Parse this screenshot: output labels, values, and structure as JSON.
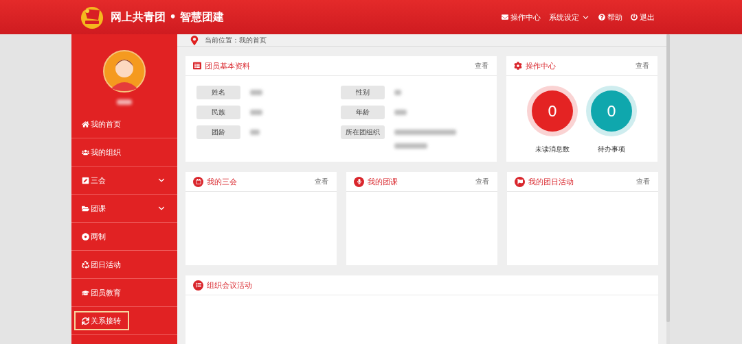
{
  "header": {
    "title": "网上共青团 • 智慧团建",
    "nav": [
      {
        "label": "操作中心",
        "kind": "link"
      },
      {
        "label": "系统设定",
        "kind": "menu"
      },
      {
        "label": "帮助",
        "kind": "link"
      },
      {
        "label": "退出",
        "kind": "link"
      }
    ]
  },
  "sidebar": {
    "items": [
      {
        "label": "我的首页",
        "kind": "link",
        "selected": false
      },
      {
        "label": "我的组织",
        "kind": "link",
        "selected": false
      },
      {
        "label": "三会",
        "kind": "group",
        "expanded": false,
        "selected": false
      },
      {
        "label": "团课",
        "kind": "group",
        "expanded": false,
        "selected": false
      },
      {
        "label": "两制",
        "kind": "link",
        "selected": false
      },
      {
        "label": "团日活动",
        "kind": "link",
        "selected": false
      },
      {
        "label": "团员教育",
        "kind": "link",
        "selected": false
      },
      {
        "label": "关系接转",
        "kind": "link",
        "selected": true
      }
    ]
  },
  "breadcrumb": "当前位置：我的首页",
  "profile_card": {
    "title": "团员基本资料",
    "action": "查看",
    "fields": [
      {
        "label": "姓名"
      },
      {
        "label": "性别"
      },
      {
        "label": "民族"
      },
      {
        "label": "年龄"
      },
      {
        "label": "团龄"
      },
      {
        "label": "所在团组织"
      }
    ]
  },
  "operations_card": {
    "title": "操作中心",
    "action": "查看",
    "stats": [
      {
        "value": "0",
        "label": "未读消息数",
        "color": "#e42323"
      },
      {
        "value": "0",
        "label": "待办事项",
        "color": "#0fa7ad"
      }
    ]
  },
  "panels": [
    {
      "title": "我的三会",
      "action": "查看"
    },
    {
      "title": "我的团课",
      "action": "查看"
    },
    {
      "title": "我的团日活动",
      "action": "查看"
    }
  ],
  "meeting_panel": {
    "title": "组织会议活动"
  }
}
